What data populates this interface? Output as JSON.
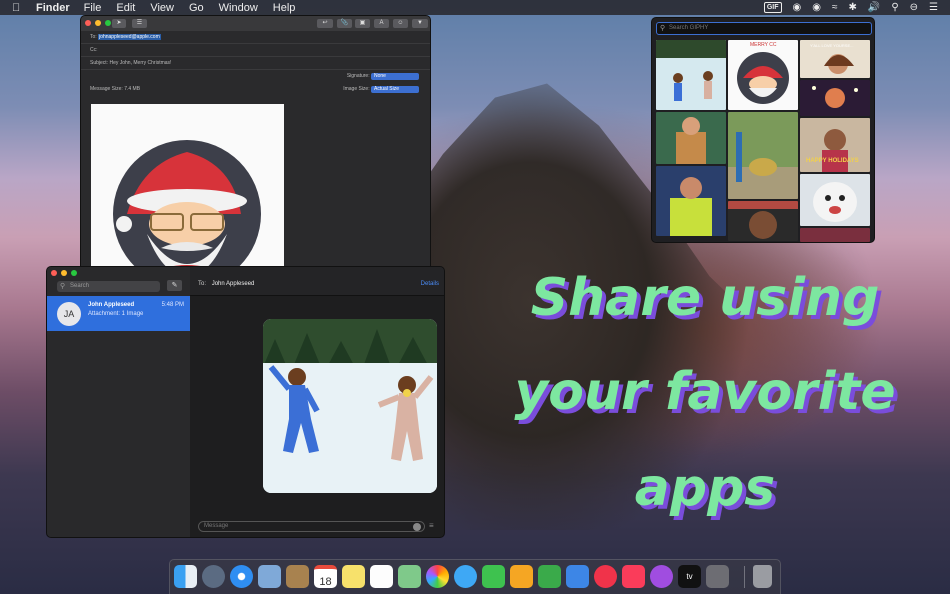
{
  "menubar": {
    "app": "Finder",
    "menus": [
      "File",
      "Edit",
      "View",
      "Go",
      "Window",
      "Help"
    ],
    "gif_badge": "GIF"
  },
  "mail": {
    "to_label": "To:",
    "to_address": "johnappleseed@apple.com",
    "cc_label": "Cc:",
    "subject_label": "Subject:",
    "subject": "Hey John, Merry Christmas!",
    "signature_label": "Signature:",
    "signature_value": "None",
    "message_size_label": "Message Size:",
    "message_size": "7.4 MB",
    "image_size_label": "Image Size:",
    "image_size_value": "Actual Size"
  },
  "giphy": {
    "search_placeholder": "Search GIPHY",
    "cell_caption_1": "MERRY CC",
    "cell_caption_2": "Y'ALL LOVE YOURSE...",
    "cell_caption_3": "HAPPY HOLIDAYS"
  },
  "messages": {
    "search_placeholder": "Search",
    "conversation": {
      "initials": "JA",
      "name": "John Appleseed",
      "time": "5:48 PM",
      "preview": "Attachment: 1 Image"
    },
    "to_label": "To:",
    "to_name": "John Appleseed",
    "details": "Details",
    "input_placeholder": "Message"
  },
  "promo": {
    "line1": "Share using",
    "line2": "your favorite",
    "line3": "apps"
  },
  "colors": {
    "accent": "#3c6fd1",
    "promo_text": "#7de7a0",
    "promo_shadow": "#7a4ddb",
    "selected_conversation": "#2f6fdd"
  },
  "dock": {
    "icons": [
      "finder-icon",
      "launchpad-icon",
      "safari-icon",
      "preview-icon",
      "contacts-icon",
      "calendar-icon",
      "notes-icon",
      "reminders-icon",
      "maps-icon",
      "photos-icon",
      "messages-icon",
      "facetime-icon",
      "pages-icon",
      "numbers-icon",
      "keynote-icon",
      "news-icon",
      "music-icon",
      "podcasts-icon",
      "tv-icon",
      "system-preferences-icon",
      "trash-icon"
    ],
    "calendar_day": "18",
    "tv_label": "tv"
  }
}
